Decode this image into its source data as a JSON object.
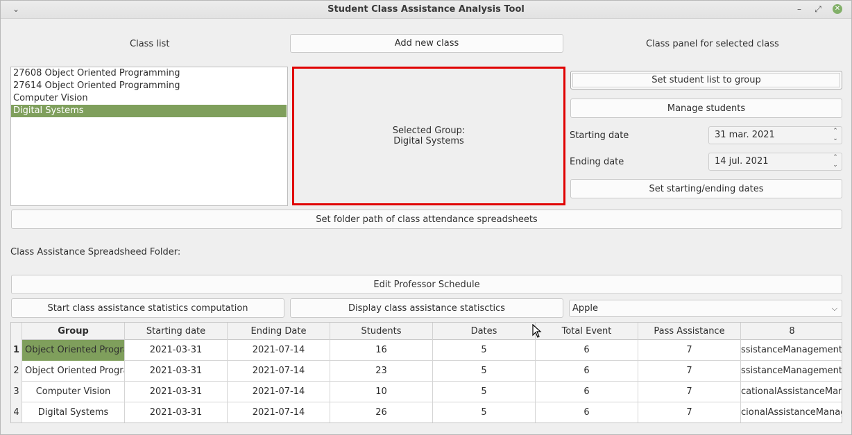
{
  "window": {
    "title": "Student Class Assistance Analysis Tool",
    "menu_icon": "chevron-down-icon",
    "minimize_icon": "minimize-icon",
    "restore_icon": "restore-icon",
    "close_icon": "close-icon",
    "close_color": "#82b069"
  },
  "labels": {
    "class_list": "Class list",
    "class_panel": "Class panel for selected class",
    "starting_date": "Starting date",
    "ending_date": "Ending date",
    "folder": "Class Assistance Spreadsheed Folder:"
  },
  "buttons": {
    "add_new_class": "Add new class",
    "set_student_list": "Set student list to group",
    "manage_students": "Manage students",
    "set_dates": "Set starting/ending dates",
    "set_folder": "Set folder path of class attendance spreadsheets",
    "edit_schedule": "Edit Professor Schedule",
    "start_computation": "Start class assistance statistics computation",
    "display_statistics": "Display class assistance statisctics"
  },
  "class_list": {
    "items": [
      {
        "label": "27608 Object Oriented Programming"
      },
      {
        "label": "27614 Object Oriented Programming"
      },
      {
        "label": "Computer Vision"
      },
      {
        "label": "Digital Systems",
        "selected": true
      }
    ],
    "selection_color": "#7f9f5c"
  },
  "selected_group": {
    "heading": "Selected Group:",
    "name": "Digital Systems",
    "border_color": "#e00000"
  },
  "dates": {
    "starting": "31 mar. 2021",
    "ending": "14 jul. 2021"
  },
  "combo": {
    "value": "Apple"
  },
  "table": {
    "columns": [
      "Group",
      "Starting date",
      "Ending Date",
      "Students",
      "Dates",
      "Total Event",
      "Pass Assistance",
      "8"
    ],
    "rows": [
      {
        "num": "1",
        "cells": [
          "Object Oriented Programming",
          "2021-03-31",
          "2021-07-14",
          "16",
          "5",
          "6",
          "7",
          "ssistanceManagement/In"
        ]
      },
      {
        "num": "2",
        "cells": [
          "Object Oriented Programming",
          "2021-03-31",
          "2021-07-14",
          "23",
          "5",
          "6",
          "7",
          "ssistanceManagement/In"
        ]
      },
      {
        "num": "3",
        "cells": [
          "Computer Vision",
          "2021-03-31",
          "2021-07-14",
          "10",
          "5",
          "6",
          "7",
          "cationalAssistanceManag"
        ]
      },
      {
        "num": "4",
        "cells": [
          "Digital Systems",
          "2021-03-31",
          "2021-07-14",
          "26",
          "5",
          "6",
          "7",
          "cionalAssistanceManagem"
        ]
      }
    ]
  }
}
